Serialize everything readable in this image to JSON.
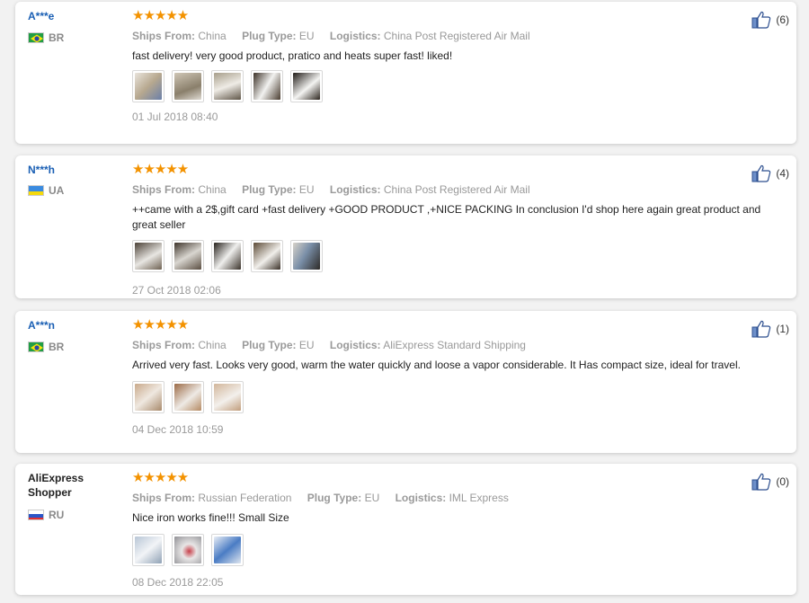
{
  "reviews": [
    {
      "user": "A***e",
      "country": "BR",
      "stars": "★★★★★",
      "ships_label": "Ships From:",
      "ships_value": "China",
      "plug_label": "Plug Type:",
      "plug_value": "EU",
      "logistics_label": "Logistics:",
      "logistics_value": "China Post Registered Air Mail",
      "text": "fast delivery! very good product, pratico and heats super fast! liked!",
      "date": "01 Jul 2018 08:40",
      "likes": "(6)"
    },
    {
      "user": "N***h",
      "country": "UA",
      "stars": "★★★★★",
      "ships_label": "Ships From:",
      "ships_value": "China",
      "plug_label": "Plug Type:",
      "plug_value": "EU",
      "logistics_label": "Logistics:",
      "logistics_value": "China Post Registered Air Mail",
      "text": "++came with a 2$,gift card +fast delivery +GOOD PRODUCT ,+NICE PACKING In conclusion I'd shop here again great product and great seller",
      "date": "27 Oct 2018 02:06",
      "likes": "(4)"
    },
    {
      "user": "A***n",
      "country": "BR",
      "stars": "★★★★★",
      "ships_label": "Ships From:",
      "ships_value": "China",
      "plug_label": "Plug Type:",
      "plug_value": "EU",
      "logistics_label": "Logistics:",
      "logistics_value": "AliExpress Standard Shipping",
      "text": "Arrived very fast. Looks very good, warm the water quickly and loose a vapor considerable. It Has compact size, ideal for travel.",
      "date": "04 Dec 2018 10:59",
      "likes": "(1)"
    },
    {
      "user": "AliExpress Shopper",
      "country": "RU",
      "stars": "★★★★★",
      "ships_label": "Ships From:",
      "ships_value": "Russian Federation",
      "plug_label": "Plug Type:",
      "plug_value": "EU",
      "logistics_label": "Logistics:",
      "logistics_value": "IML Express",
      "text": "Nice iron works fine!!! Small Size",
      "date": "08 Dec 2018 22:05",
      "likes": "(0)"
    }
  ],
  "colors": {
    "star": "#f39200",
    "username": "#1a5fb4",
    "muted": "#999999"
  },
  "icons": {
    "like": "thumbs-up-icon",
    "photo": "photo-thumbnail"
  }
}
